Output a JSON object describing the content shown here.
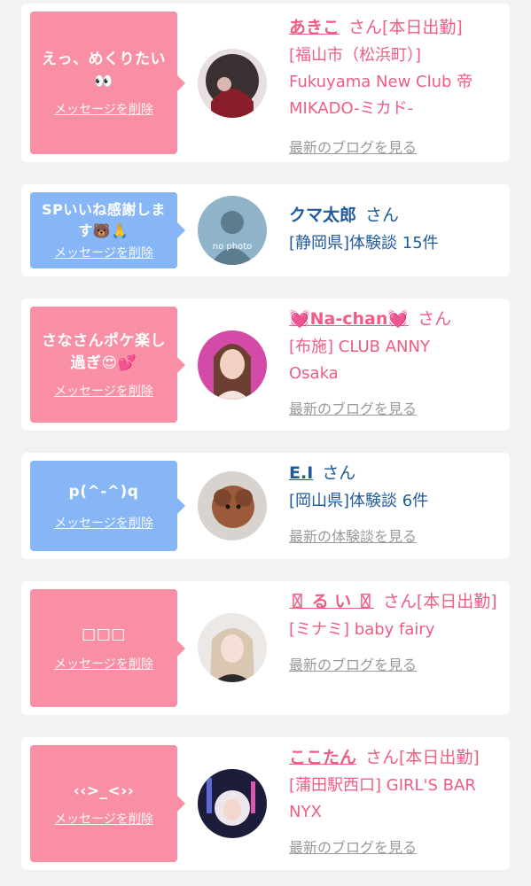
{
  "delete_label": "メッセージを削除",
  "items": [
    {
      "message": "えっ、めくりたい\n👀",
      "name": "あきこ",
      "suffix": "さん[本日出勤]",
      "shop": "[福山市（松浜町）] Fukuyama New Club 帝 MIKADO-ミカド-",
      "link": "最新のブログを見る"
    },
    {
      "message": "SPいいね感謝します🐻🙏",
      "name": "クマ太郎",
      "suffix": "さん",
      "shop": "[静岡県]体験談 15件",
      "link": "",
      "avatar_text": "no photo"
    },
    {
      "message": "さなさんポケ楽し過ぎ😍💕",
      "name": "💓Na-chan💓",
      "suffix": "さん",
      "shop": "[布施] CLUB ANNY Osaka",
      "link": "最新のブログを見る"
    },
    {
      "message": "p(^-^)q",
      "name": "E.I",
      "suffix": "さん",
      "shop": "[岡山県]体験談 6件",
      "link": "最新の体験談を見る"
    },
    {
      "message": "□□□",
      "name": "〿 る い 〿",
      "suffix": "さん[本日出勤]",
      "shop": "[ミナミ] baby fairy",
      "link": "最新のブログを見る"
    },
    {
      "message": "‹‹>_<››",
      "name": "ここたん",
      "suffix": "さん[本日出勤]",
      "shop": "[蒲田駅西口] GIRL'S BAR NYX",
      "link": "最新のブログを見る"
    }
  ],
  "colors": {
    "pink_bubble": "#f98fa5",
    "blue_bubble": "#86b6f6",
    "girl_text": "#ef5d83",
    "user_text": "#1f5a9a",
    "link_gray": "#999999"
  }
}
